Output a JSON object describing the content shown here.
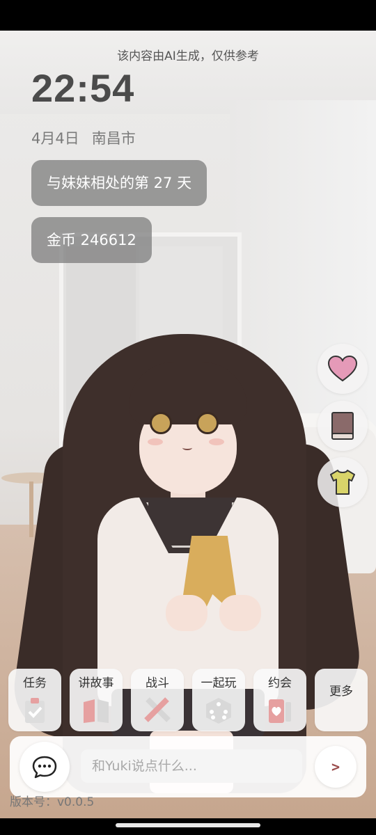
{
  "notice": "该内容由AI生成，仅供参考",
  "clock": "22:54",
  "date": "4月4日",
  "city": "南昌市",
  "stats": {
    "days_together": "与妹妹相处的第 27 天",
    "coins": "金币 246612"
  },
  "side_buttons": [
    {
      "icon": "heart-icon",
      "color": "#e59ab8"
    },
    {
      "icon": "book-icon",
      "color": "#8a6a6a"
    },
    {
      "icon": "shirt-icon",
      "color": "#d9d46a"
    }
  ],
  "actions": [
    {
      "label": "任务",
      "icon": "clipboard-check-icon"
    },
    {
      "label": "讲故事",
      "icon": "open-book-icon"
    },
    {
      "label": "战斗",
      "icon": "crossed-swords-icon"
    },
    {
      "label": "一起玩",
      "icon": "dice-icon"
    },
    {
      "label": "约会",
      "icon": "heart-card-icon"
    },
    {
      "label": "更多",
      "icon": ""
    }
  ],
  "chat": {
    "placeholder": "和Yuki说点什么...",
    "send_label": ">"
  },
  "version": "版本号：v0.0.5"
}
